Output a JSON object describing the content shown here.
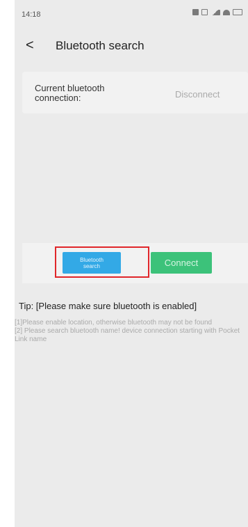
{
  "status_bar": {
    "time": "14:18"
  },
  "header": {
    "back_glyph": "<",
    "title": "Bluetooth search"
  },
  "connection": {
    "label": "Current bluetooth connection:",
    "value": "Disconnect"
  },
  "buttons": {
    "search_label": "Bluetooth search",
    "connect_label": "Connect"
  },
  "tip": {
    "title": "Tip: [Please make sure bluetooth is enabled]",
    "lines": [
      "[1]Please enable location, otherwise bluetooth may not be found",
      "[2] Please search bluetooth name! device connection starting with Pocket Link name"
    ]
  },
  "colors": {
    "background": "#ebebeb",
    "card": "#f2f2f2",
    "search_button": "#33a9e6",
    "connect_button": "#3cc27a",
    "highlight": "#e0262a"
  },
  "icons": {
    "status": [
      "vibrate-icon",
      "nfc-icon",
      "signal-icon",
      "wifi-icon",
      "battery-icon"
    ],
    "back": "chevron-left-icon"
  }
}
